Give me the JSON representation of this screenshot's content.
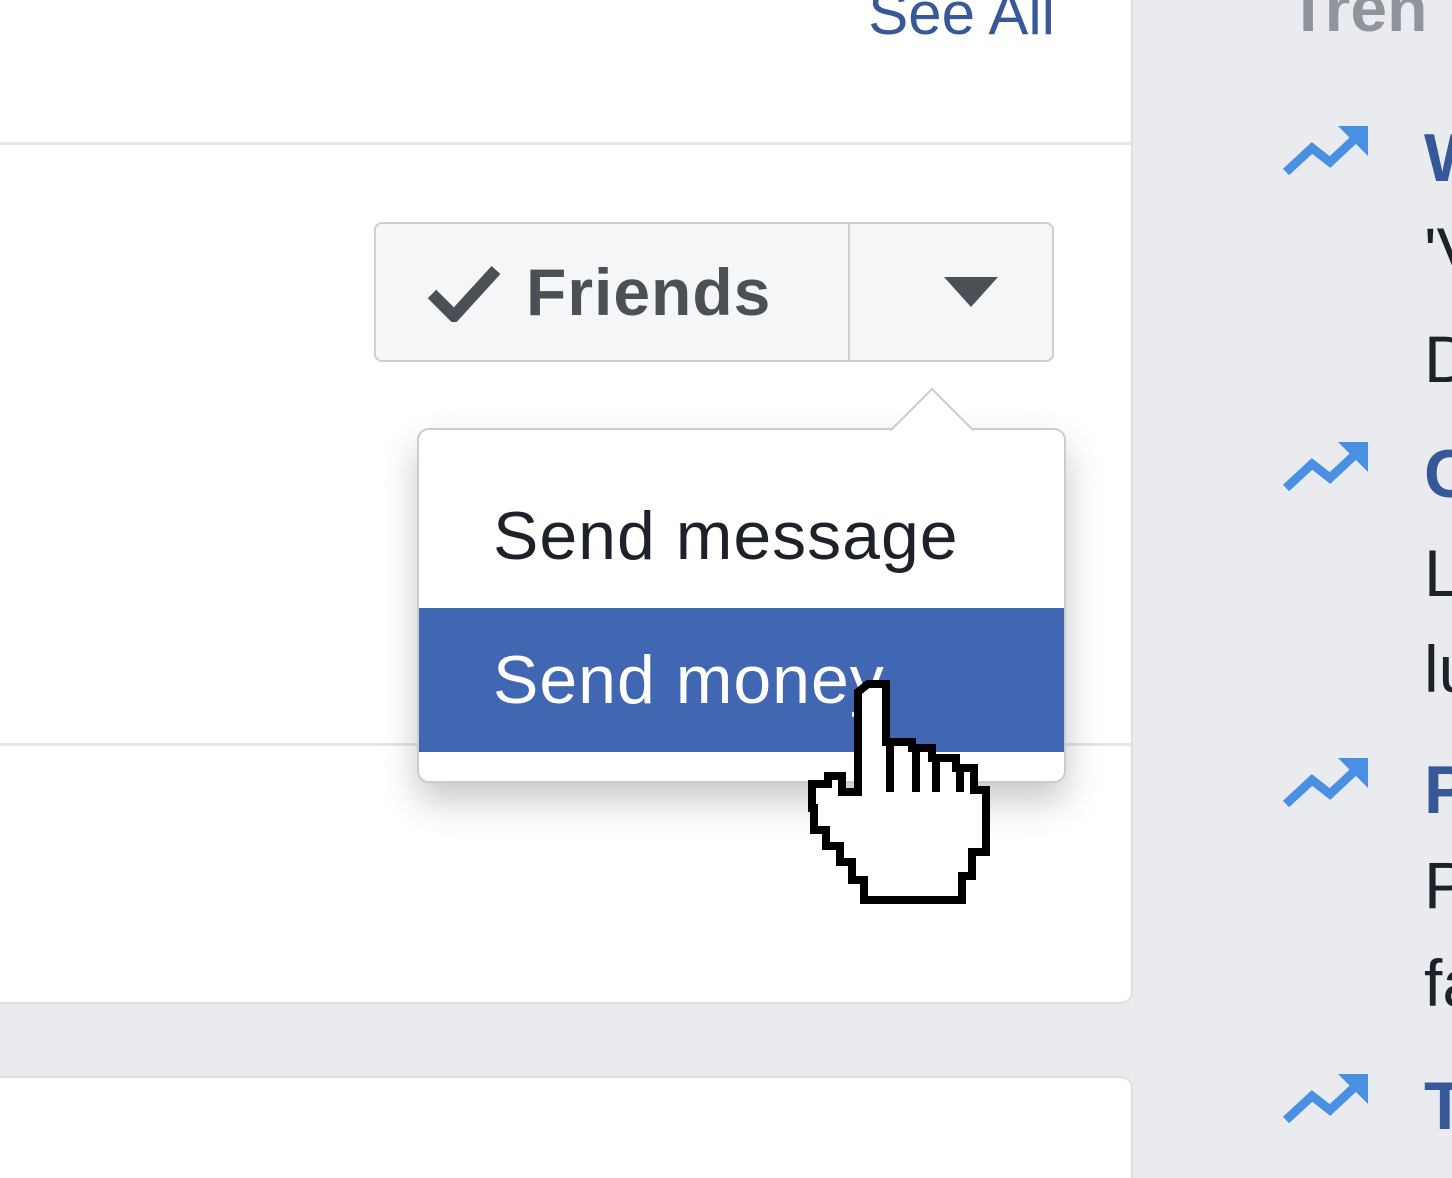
{
  "feed": {
    "see_all": "See All"
  },
  "friend_button": {
    "label": "Friends",
    "icon": "check-icon",
    "dropdown_icon": "caret-down-icon"
  },
  "menu": {
    "items": [
      {
        "label": "Send message",
        "highlighted": false
      },
      {
        "label": "Send money",
        "highlighted": true
      }
    ],
    "highlight_color": "#4267b2"
  },
  "trending": {
    "header": "Tren",
    "items": [
      {
        "title": "W",
        "line1": "'V",
        "line2": "D"
      },
      {
        "title": "C",
        "line1": "L",
        "line2": "lu"
      },
      {
        "title": "P",
        "line1": "P",
        "line2": "fa"
      },
      {
        "title": "T"
      }
    ],
    "icon": "trending-arrow-icon",
    "accent": "#4a90e2"
  }
}
